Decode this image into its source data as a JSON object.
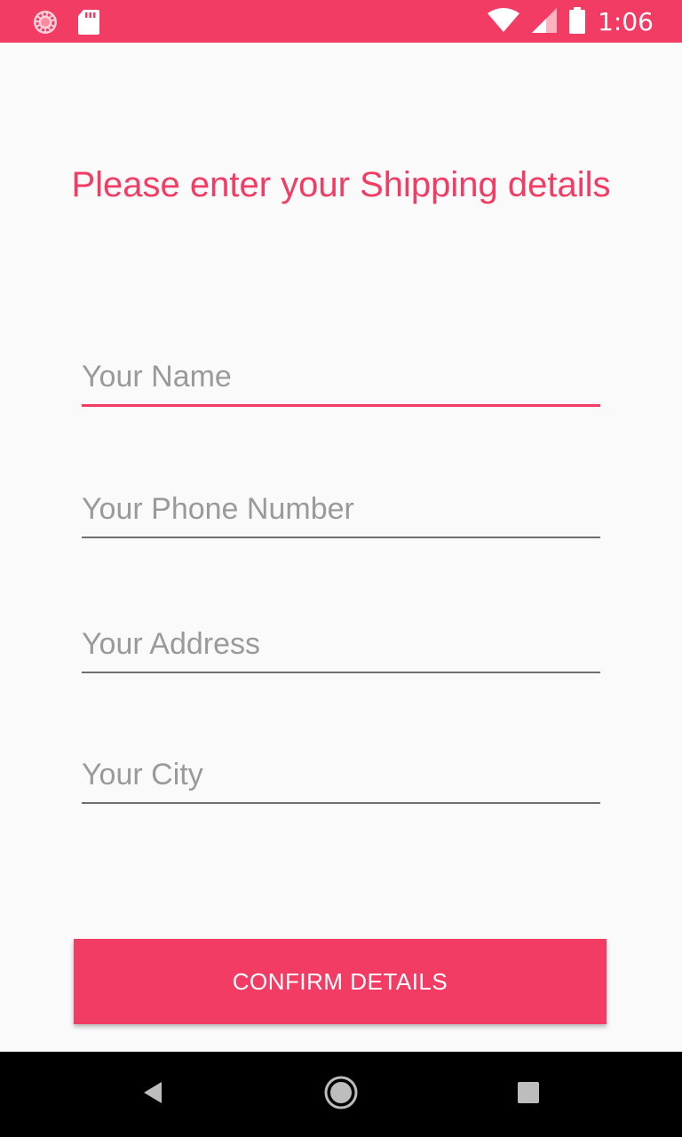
{
  "status_bar": {
    "time": "1:06",
    "icons": [
      "sync-icon",
      "sd-card-icon",
      "wifi-icon",
      "cellular-signal-icon",
      "battery-icon"
    ],
    "background": "#f23c63"
  },
  "title": "Please enter your Shipping details",
  "form": {
    "name_placeholder": "Your Name",
    "phone_placeholder": "Your Phone Number",
    "address_placeholder": "Your Address",
    "city_placeholder": "Your City"
  },
  "confirm_label": "CONFIRM DETAILS",
  "nav_bar": {
    "icons": [
      "back-icon",
      "home-icon",
      "recents-icon"
    ]
  },
  "colors": {
    "accent": "#f23c63",
    "background": "#fafafa",
    "placeholder": "#9a9a9a",
    "underline": "#6f6f6f"
  }
}
